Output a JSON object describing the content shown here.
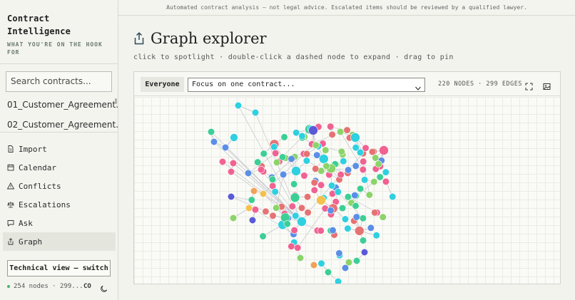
{
  "banner": "Automated contract analysis — not legal advice. Escalated items should be reviewed by a qualified lawyer.",
  "brand": {
    "title_line1": "Contract",
    "title_line2": "Intelligence",
    "subtitle_line1": "WHAT YOU'RE ON THE HOOK",
    "subtitle_line2": "FOR"
  },
  "search": {
    "placeholder": "Search contracts..."
  },
  "contracts": [
    "01_Customer_Agreement...",
    "02_Customer_Agreement..."
  ],
  "nav": [
    {
      "label": "Import",
      "icon": "file-icon"
    },
    {
      "label": "Calendar",
      "icon": "calendar-icon"
    },
    {
      "label": "Conflicts",
      "icon": "warning-icon"
    },
    {
      "label": "Escalations",
      "icon": "scale-icon"
    },
    {
      "label": "Ask",
      "icon": "chat-icon"
    },
    {
      "label": "Graph",
      "icon": "share-icon",
      "active": true
    }
  ],
  "tech_button": "Technical view — switch",
  "footer": {
    "stats": "254 nodes · 299...",
    "co": "CO"
  },
  "page": {
    "title": "Graph explorer",
    "subtitle": "click to spotlight · double-click a dashed node to expand · drag to pin"
  },
  "toolbar": {
    "everyone_label": "Everyone",
    "focus_select_value": "Focus on one contract...",
    "stats": "220 NODES · 299 EDGES"
  },
  "colors": {
    "accent_green": "#4caf6a",
    "node_palette": [
      "#3ccf95",
      "#2fd0e0",
      "#5b8ee6",
      "#f06292",
      "#8bd46a",
      "#e57373",
      "#f0a259",
      "#9d8ee8",
      "#5a5ad8",
      "#f2c14e"
    ]
  }
}
